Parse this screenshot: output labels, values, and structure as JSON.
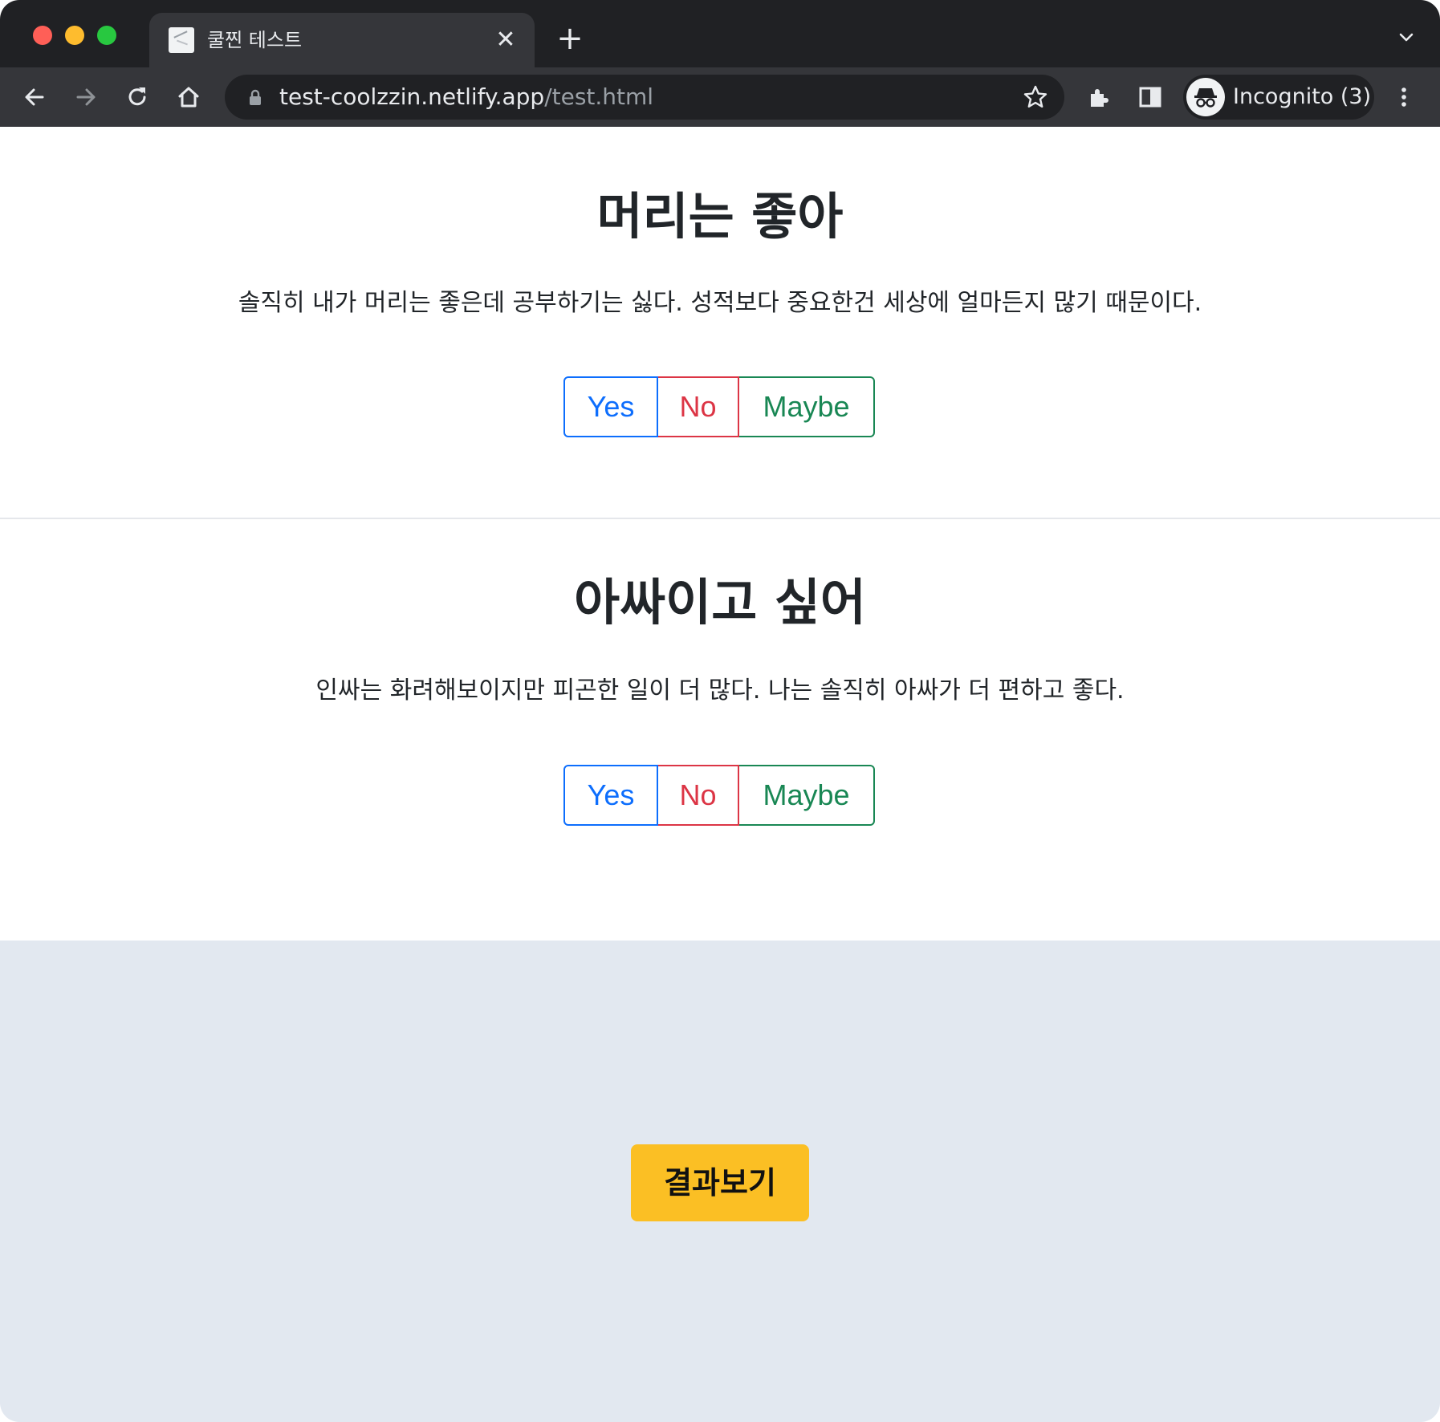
{
  "browser": {
    "tab_title": "쿨찐 테스트",
    "tab_close_glyph": "✕",
    "new_tab_glyph": "+",
    "url_host": "test-coolzzin.netlify.app",
    "url_path": "/test.html",
    "profile_label": "Incognito (3)",
    "icons": [
      "back-icon",
      "forward-icon",
      "reload-icon",
      "home-icon",
      "lock-icon",
      "star-icon",
      "extensions-icon",
      "sidepanel-icon",
      "incognito-icon",
      "menu-icon",
      "tab-search-icon"
    ]
  },
  "questions": [
    {
      "title": "머리는 좋아",
      "description": "솔직히 내가 머리는 좋은데 공부하기는 싫다. 성적보다 중요한건 세상에 얼마든지 많기 때문이다.",
      "options": {
        "yes": "Yes",
        "no": "No",
        "maybe": "Maybe"
      }
    },
    {
      "title": "아싸이고 싶어",
      "description": "인싸는 화려해보이지만 피곤한 일이 더 많다. 나는 솔직히 아싸가 더 편하고 좋다.",
      "options": {
        "yes": "Yes",
        "no": "No",
        "maybe": "Maybe"
      }
    }
  ],
  "result_button": "결과보기",
  "colors": {
    "yes": "#0d6efd",
    "no": "#dc3545",
    "maybe": "#198754",
    "result_button_bg": "#fbbf24",
    "footer_bg": "#e2e8f0"
  }
}
